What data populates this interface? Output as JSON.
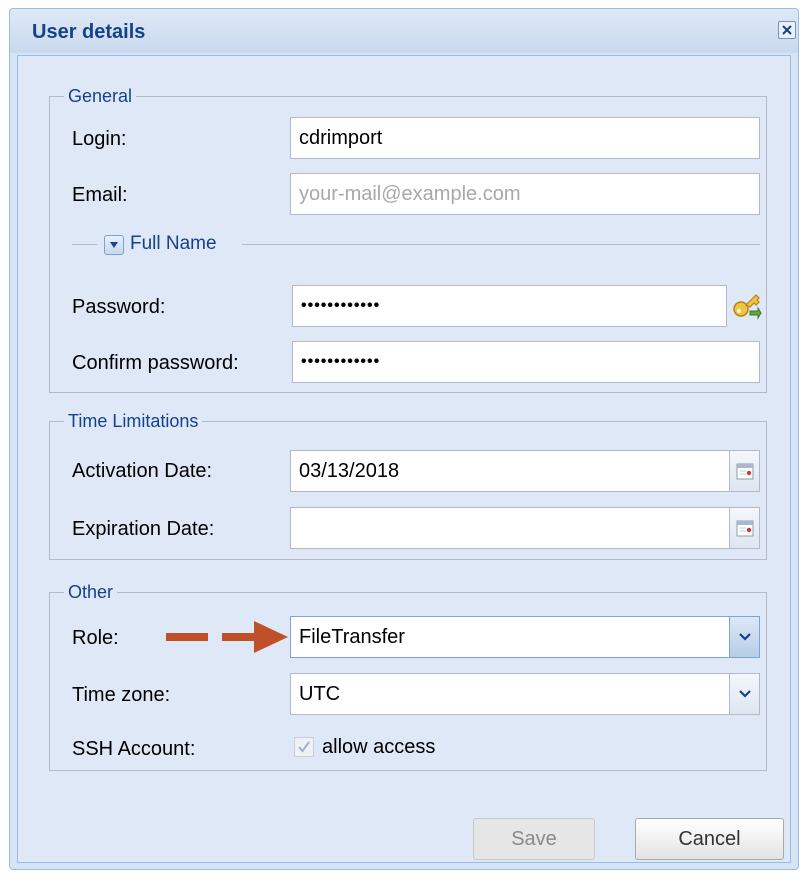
{
  "window": {
    "title": "User details"
  },
  "general": {
    "legend": "General",
    "login_label": "Login:",
    "login_value": "cdrimport",
    "email_label": "Email:",
    "email_placeholder": "your-mail@example.com",
    "fullname_label": "Full Name",
    "password_label": "Password:",
    "password_value": "••••••••••••",
    "confirm_label": "Confirm password:",
    "confirm_value": "••••••••••••"
  },
  "time_limitations": {
    "legend": "Time Limitations",
    "activation_label": "Activation Date:",
    "activation_value": "03/13/2018",
    "expiration_label": "Expiration Date:",
    "expiration_value": ""
  },
  "other": {
    "legend": "Other",
    "role_label": "Role:",
    "role_value": "FileTransfer",
    "timezone_label": "Time zone:",
    "timezone_value": "UTC",
    "ssh_label": "SSH Account:",
    "ssh_checkbox_label": "allow access",
    "ssh_checked": true
  },
  "buttons": {
    "save": "Save",
    "cancel": "Cancel"
  },
  "annotation": {
    "arrow_color": "#c0502a"
  },
  "icons": {
    "close": "close-icon",
    "expand": "chevron-down-icon",
    "generate_password": "key-icon",
    "calendar": "calendar-icon",
    "dropdown": "chevron-down-icon",
    "check": "checkmark-icon"
  }
}
